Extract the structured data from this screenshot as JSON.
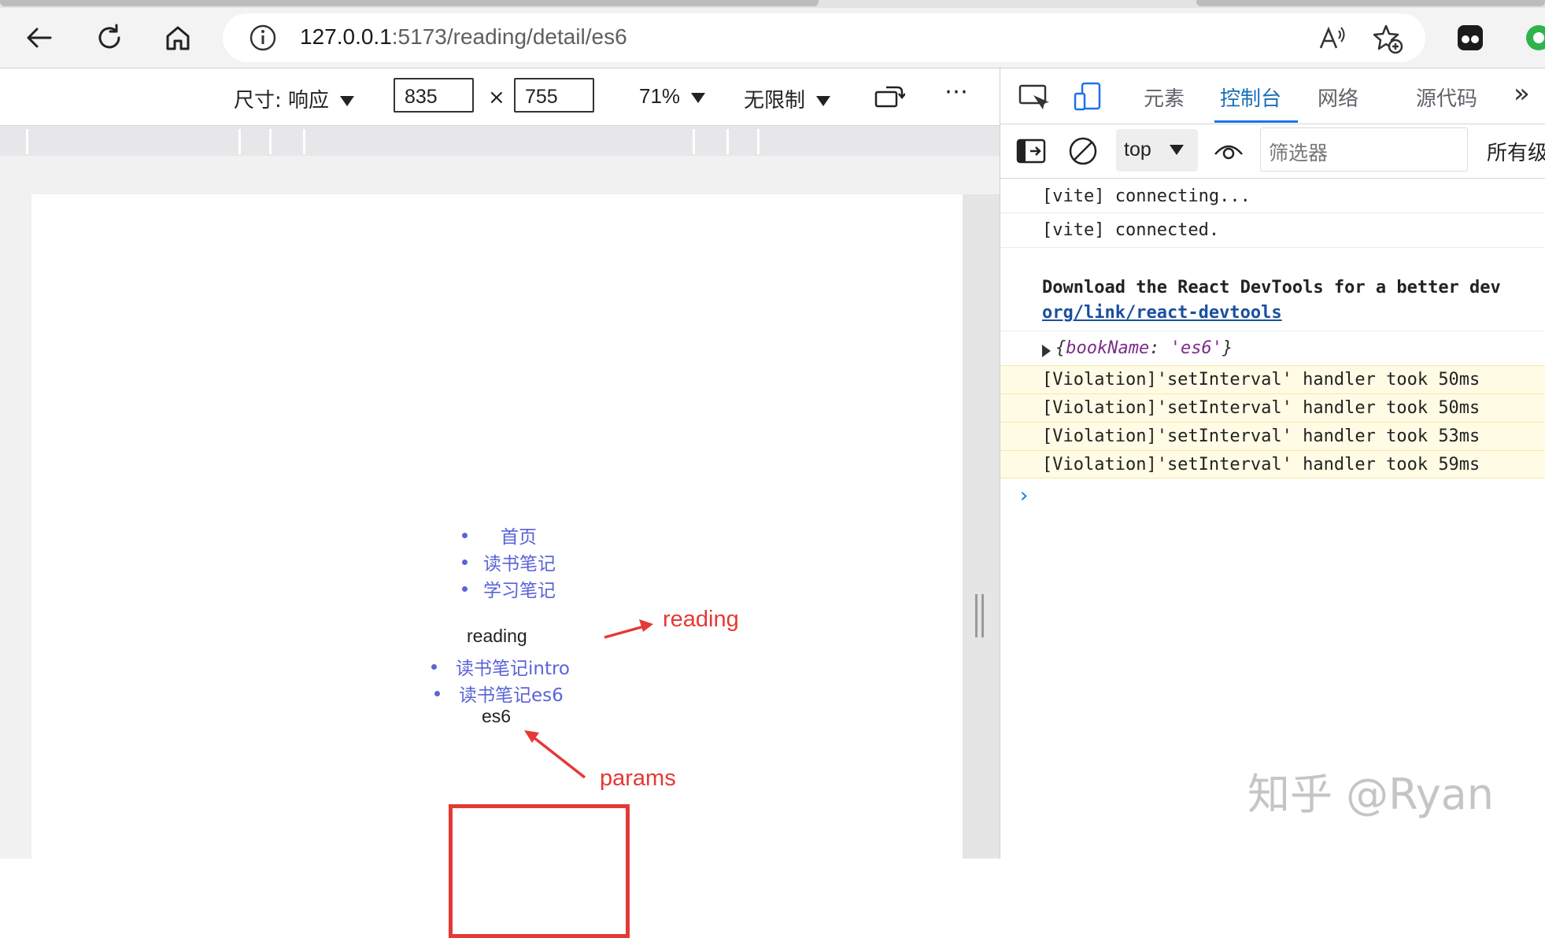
{
  "browser": {
    "url_host": "127.0.0.1",
    "url_path": ":5173/reading/detail/es6",
    "icons": [
      "back-arrow-icon",
      "refresh-icon",
      "home-icon",
      "info-icon",
      "read-aloud-icon",
      "favorite-add-icon",
      "extension-icon",
      "extension-icon"
    ]
  },
  "device_toolbar": {
    "dimensions_label": "尺寸: 响应",
    "width": "835",
    "times": "×",
    "height": "755",
    "zoom": "71%",
    "throttle": "无限制",
    "more": "⋯",
    "icons": [
      "rotate-icon",
      "more-icon"
    ]
  },
  "page": {
    "nav_items": [
      "首页",
      "读书笔记",
      "学习笔记"
    ],
    "reading_title": "reading",
    "sub_items": [
      "读书笔记intro",
      "读书笔记es6"
    ],
    "param_value": "es6",
    "annotation_reading": "reading",
    "annotation_params": "params",
    "colors": {
      "link": "#5a63d8",
      "annotation": "#e53935"
    }
  },
  "devtools": {
    "tabs": [
      "元素",
      "控制台",
      "网络",
      "源代码"
    ],
    "active_tab": "控制台",
    "overflow": "»",
    "context": "top",
    "filter_placeholder": "筛选器",
    "levels": "所有级",
    "console": {
      "vite_connecting": "[vite] connecting...",
      "vite_connected": "[vite] connected.",
      "react_msg": "Download the React DevTools for a better dev",
      "react_link": "org/link/react-devtools",
      "obj_open": "{",
      "obj_key": "bookName",
      "obj_colon": ": ",
      "obj_val": "'es6'",
      "obj_close": "}",
      "violations": [
        "[Violation]'setInterval' handler took 50ms",
        "[Violation]'setInterval' handler took 50ms",
        "[Violation]'setInterval' handler took 53ms",
        "[Violation]'setInterval' handler took 59ms"
      ],
      "prompt": "›"
    }
  },
  "watermark": "知乎 @Ryan"
}
